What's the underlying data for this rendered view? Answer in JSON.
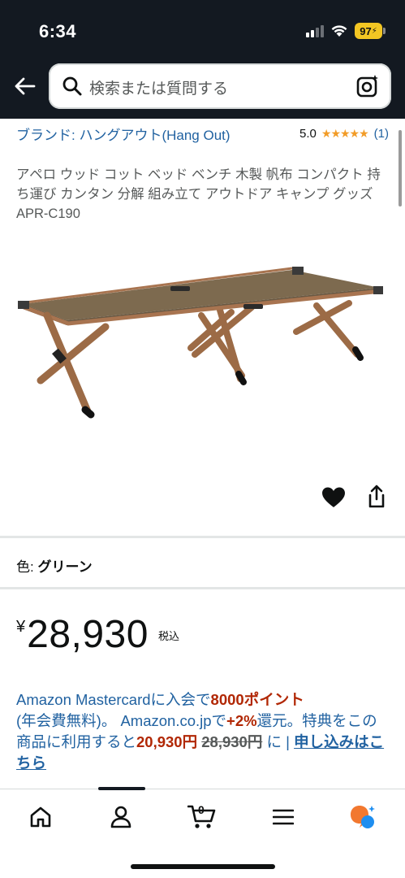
{
  "status_bar": {
    "time": "6:34",
    "battery": "97"
  },
  "search": {
    "placeholder": "検索または質問する"
  },
  "product": {
    "brand": "ブランド: ハングアウト(Hang Out)",
    "rating_value": "5.0",
    "rating_stars": "★★★★★",
    "rating_count": "(1)",
    "title": "アペロ ウッド コット ベッド ベンチ 木製 帆布 コンパクト 持ち運び カンタン 分解 組み立て アウトドア キャンプ グッズ APR-C190",
    "color_label": "色: ",
    "color_value": "グリーン",
    "price_symbol": "¥",
    "price": "28,930",
    "tax_label": "税込"
  },
  "promo": {
    "text1": "Amazon Mastercardに入会で",
    "points": "8000ポイント",
    "text2": "(年会費無料)。 Amazon.co.jpで",
    "rate": "+2%",
    "text3": "還元。特典をこの商品に利用すると",
    "discounted": "20,930円",
    "original": "28,930円",
    "text4": " に | ",
    "link": "申し込みはこちら"
  },
  "nav": {
    "items": [
      "home",
      "account",
      "cart",
      "menu",
      "rufus"
    ],
    "cart_count": "0"
  },
  "colors": {
    "header": "#131921",
    "link": "#2162a1",
    "price_red": "#b12704",
    "star": "#f29c27"
  }
}
